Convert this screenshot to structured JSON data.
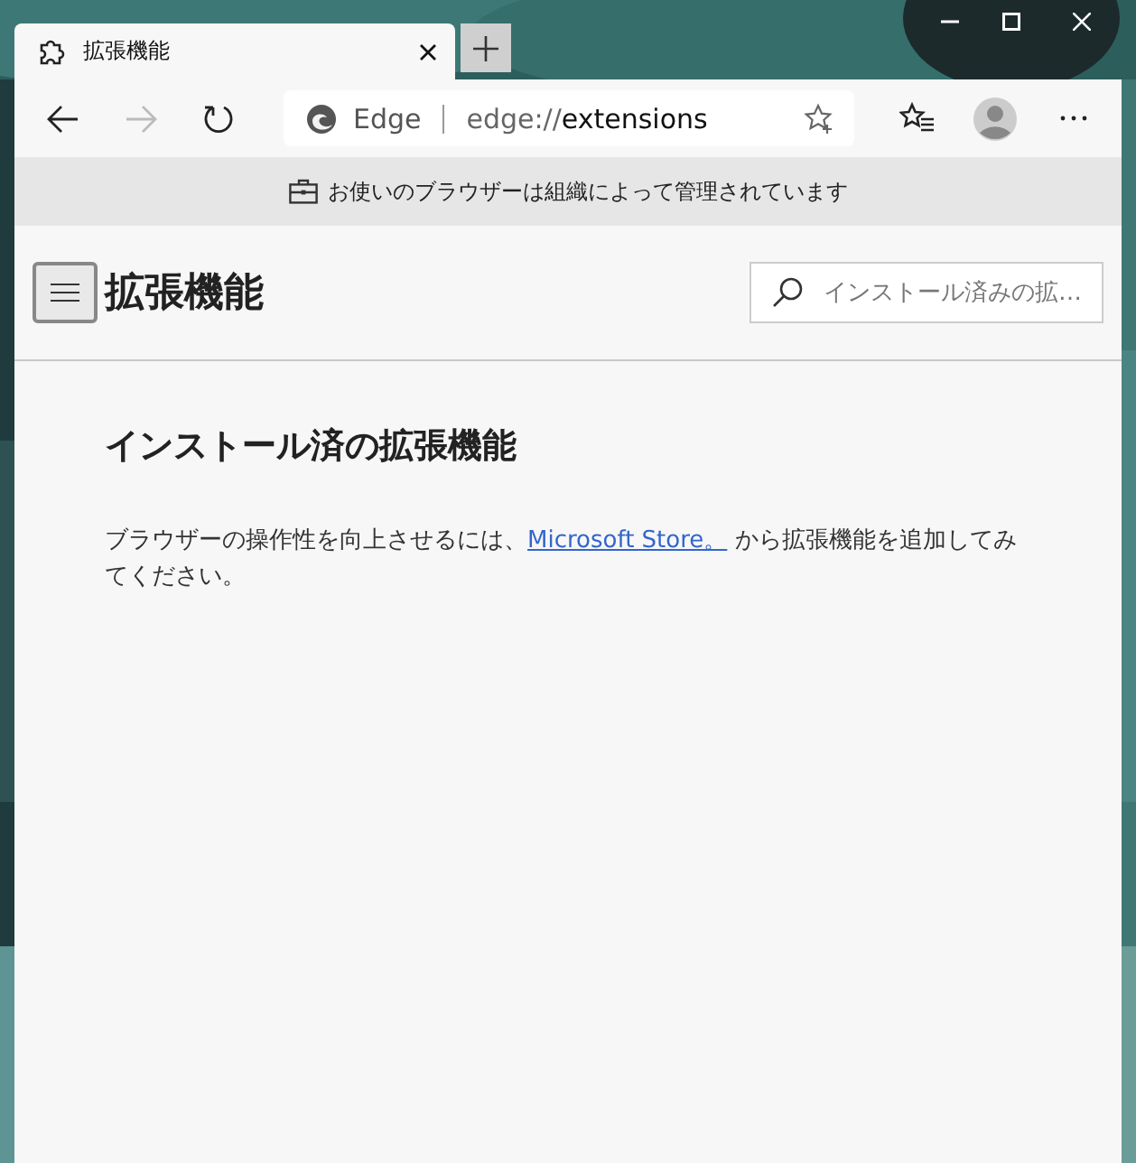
{
  "tabs": [
    {
      "title": "拡張機能",
      "selected": true
    }
  ],
  "toolbar": {
    "back_disabled": false,
    "forward_disabled": true
  },
  "address_bar": {
    "site_label": "Edge",
    "url_prefix": "edge://",
    "url_path": "extensions"
  },
  "info_bar": {
    "text": "お使いのブラウザーは組織によって管理されています"
  },
  "page": {
    "title": "拡張機能",
    "search": {
      "placeholder": "インストール済みの拡…"
    },
    "section_title": "インストール済の拡張機能",
    "paragraph": {
      "before": "ブラウザーの操作性を向上させるには、",
      "link": "Microsoft Store。",
      "after": " から拡張機能を追加してみてください。"
    }
  }
}
